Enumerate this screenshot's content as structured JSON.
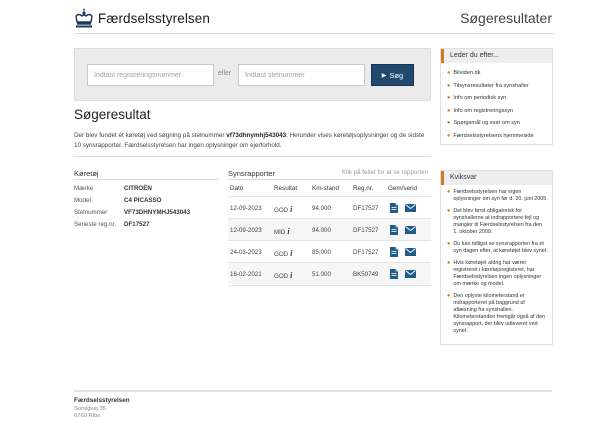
{
  "header": {
    "logo_text": "Færdselsstyrelsen",
    "page_heading": "Søgeresultater"
  },
  "search": {
    "reg_placeholder": "Indtast registreringsnummer",
    "or_label": "eller",
    "stel_placeholder": "Indtast stelnummer",
    "button_label": "Søg"
  },
  "result": {
    "title": "Søgeresultat",
    "intro_pre": "Der blev fundet ét køretøj ved søgning på stelnummer ",
    "intro_vin": "vf73dhnymhj543043",
    "intro_post": ". Herunder vises køretøjsoplysninger og de sidste 10 synsrapporter. Færdselsstyrelsen har ingen oplysninger om ejerforhold."
  },
  "vehicle": {
    "section_title": "Køretøj",
    "rows": [
      {
        "key": "Mærke",
        "value": "CITROËN"
      },
      {
        "key": "Model",
        "value": "C4 PICASSO"
      },
      {
        "key": "Stelnummer",
        "value": "VF73DHNYMHJ543043"
      },
      {
        "key": "Seneste reg.nr.",
        "value": "DF17527"
      }
    ]
  },
  "reports": {
    "section_title": "Synsrapporter",
    "sort_hint": "Klik på feltet for at se rapporten",
    "columns": [
      "Dato",
      "Resultat",
      "Km-stand",
      "Reg.nr.",
      "Gem/send"
    ],
    "rows": [
      {
        "date": "12-09-2023",
        "result": "GOD",
        "km": "94.000",
        "reg": "DF17527"
      },
      {
        "date": "12-09-2023",
        "result": "MID",
        "km": "94.000",
        "reg": "DF17527"
      },
      {
        "date": "24-03-2023",
        "result": "GOD",
        "km": "85.000",
        "reg": "DF17527"
      },
      {
        "date": "16-02-2021",
        "result": "GOD",
        "km": "51.000",
        "reg": "BK59749"
      }
    ]
  },
  "sidebar": {
    "leder_title": "Leder du efter...",
    "leder_items": [
      "Bilviden.dk",
      "Tilsynsresultater fra synshaller",
      "Info om periodisk syn",
      "Info om registreringssyn",
      "Spørgsmål og svar om syn",
      "Færdselsstyrelsens hjemmeside"
    ],
    "kvik_title": "Kviksvar",
    "kvik_items": [
      "Færdselsstyrelsen har ingen oplysninger om syn før d. 20. juni 2005.",
      "Det blev først obligatorisk for synshallerne at indrapportere fejl og mangler til Færdselsstyrelsen fra den 1. oktober 2009.",
      "Du kan tidligst se synsrapporten fra et syn dagen efter, at køretøjet blev synet.",
      "Hvis køretøjet aldrig har været registreret i køretøjsregisteret, har Færdselsstyrelsen ingen oplysninger om mærke og model.",
      "Den oplyste kilometerstand er indrapporteret på baggrund af aflæsning fra synshallen. Kilometerstanden fremgår også af den synsrapport, der blev udleveret ved synet."
    ]
  },
  "footer": {
    "name": "Færdselsstyrelsen",
    "address_line1": "Sorsigvej 35",
    "address_line2": "6760 Ribe"
  },
  "colors": {
    "button": "#21496e",
    "accent": "#d47a1c",
    "icon_blue": "#1f5c8a"
  }
}
